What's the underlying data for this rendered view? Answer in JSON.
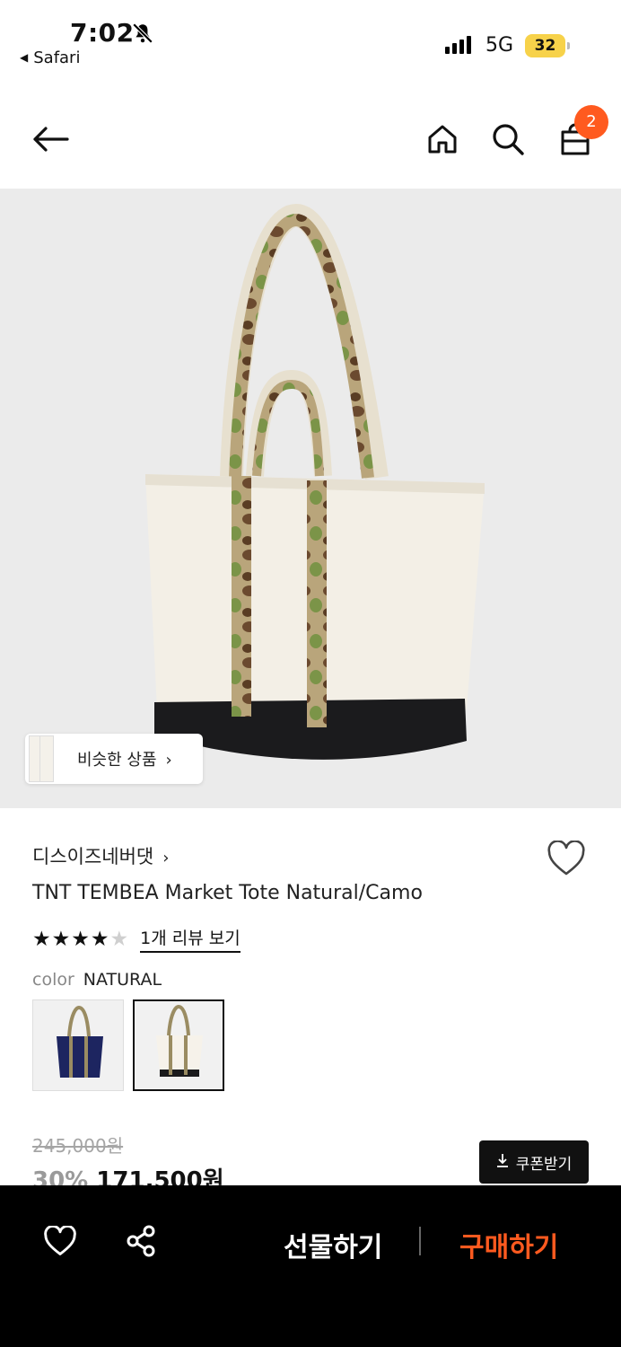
{
  "status_bar": {
    "time": "7:02",
    "back_app": "Safari",
    "network": "5G",
    "battery": "32"
  },
  "header": {
    "cart_count": "2"
  },
  "similar_products": {
    "label": "비슷한 상품",
    "chevron": "›"
  },
  "product": {
    "brand": "디스이즈네버댓",
    "brand_chevron": "›",
    "name": "TNT TEMBEA Market Tote Natural/Camo",
    "rating_stars": 4,
    "rating_max": 5,
    "review_link": "1개 리뷰 보기",
    "color_label": "color",
    "color_value": "NATURAL",
    "swatches": [
      "navy",
      "natural"
    ],
    "selected_swatch": 1
  },
  "price": {
    "original": "245,000원",
    "discount": "30%",
    "sale": "171,500원",
    "coupon_label": "쿠폰받기"
  },
  "bottom_bar": {
    "gift_label": "선물하기",
    "buy_label": "구매하기"
  },
  "colors": {
    "accent": "#ff5a1f",
    "bar": "#000000",
    "battery": "#f7d24a"
  },
  "icons": [
    "bell-off-icon",
    "back-arrow-icon",
    "home-icon",
    "search-icon",
    "cart-icon",
    "heart-outline-icon",
    "share-icon",
    "download-icon",
    "star-icon"
  ]
}
